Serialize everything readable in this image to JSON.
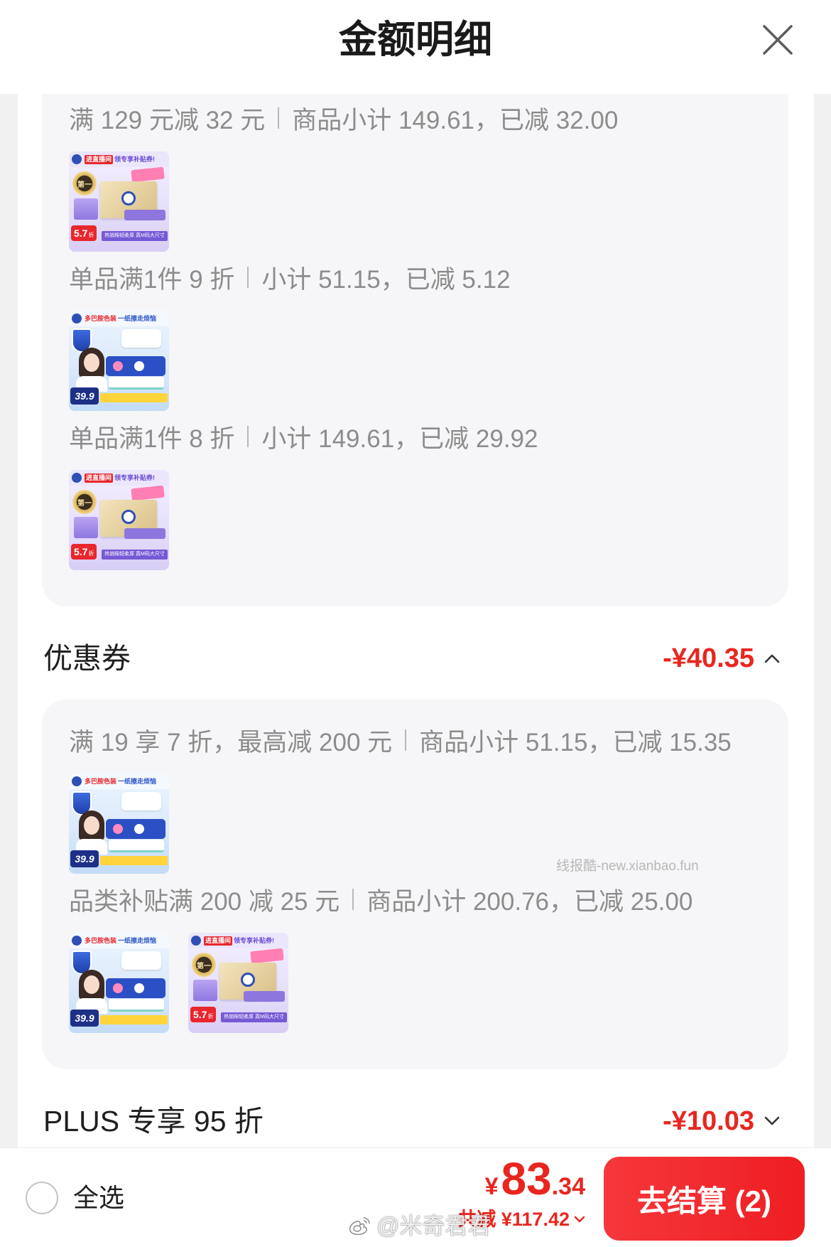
{
  "header": {
    "title": "金额明细"
  },
  "promotion_rules": [
    {
      "rule": "满 129 元减 32 元",
      "detail": "商品小计 149.61，已减 32.00",
      "products": [
        {
          "image": "tissue-product-image",
          "banner_tag": "进直播间",
          "banner_text": "领专享补贴券!",
          "badge": "第一",
          "discount_value": "5.7",
          "discount_unit": "折",
          "slogan": "热销棉韧柔厚 真M码大尺寸"
        }
      ]
    },
    {
      "rule": "单品满1件 9 折",
      "detail": "小计 51.15，已减 5.12",
      "products": [
        {
          "image": "wipes-product-image",
          "banner_tag": "多巴胺色装",
          "banner_text": "一纸擦走烦恼",
          "price": "39.9"
        }
      ]
    },
    {
      "rule": "单品满1件 8 折",
      "detail": "小计 149.61，已减 29.92",
      "products": [
        {
          "image": "tissue-product-image",
          "banner_tag": "进直播间",
          "banner_text": "领专享补贴券!",
          "badge": "第一",
          "discount_value": "5.7",
          "discount_unit": "折",
          "slogan": "热销棉韧柔厚 真M码大尺寸"
        }
      ]
    }
  ],
  "coupons": {
    "label": "优惠券",
    "amount": "-¥40.35",
    "expanded": true,
    "rules": [
      {
        "rule": "满 19 享 7 折，最高减 200 元",
        "detail": "商品小计 51.15，已减 15.35",
        "products": [
          {
            "image": "wipes-product-image",
            "banner_tag": "多巴胺色装",
            "banner_text": "一纸擦走烦恼",
            "price": "39.9"
          }
        ]
      },
      {
        "rule": "品类补贴满 200 减 25 元",
        "detail": "商品小计 200.76，已减 25.00",
        "products": [
          {
            "image": "wipes-product-image",
            "banner_tag": "多巴胺色装",
            "banner_text": "一纸擦走烦恼",
            "price": "39.9"
          },
          {
            "image": "tissue-product-image",
            "banner_tag": "进直播间",
            "banner_text": "领专享补贴券!",
            "badge": "第一",
            "discount_value": "5.7",
            "discount_unit": "折",
            "slogan": "热销棉韧柔厚 真M码大尺寸"
          }
        ]
      }
    ]
  },
  "plus": {
    "label": "PLUS 专享 95 折",
    "amount": "-¥10.03",
    "expanded": false
  },
  "footer": {
    "select_all_label": "全选",
    "select_all_checked": false,
    "currency": "¥",
    "total_integer": "83",
    "total_decimal": ".34",
    "saved_label": "共减 ¥117.42",
    "checkout_label": "去结算 (2)"
  },
  "watermarks": {
    "site": "线报酷-new.xianbao.fun",
    "weibo": "@米奇君君"
  },
  "colors": {
    "accent": "#e8261f",
    "checkout_button": "#f2302e",
    "card_background": "#f6f6f8",
    "muted_text": "#8c8c8c"
  }
}
